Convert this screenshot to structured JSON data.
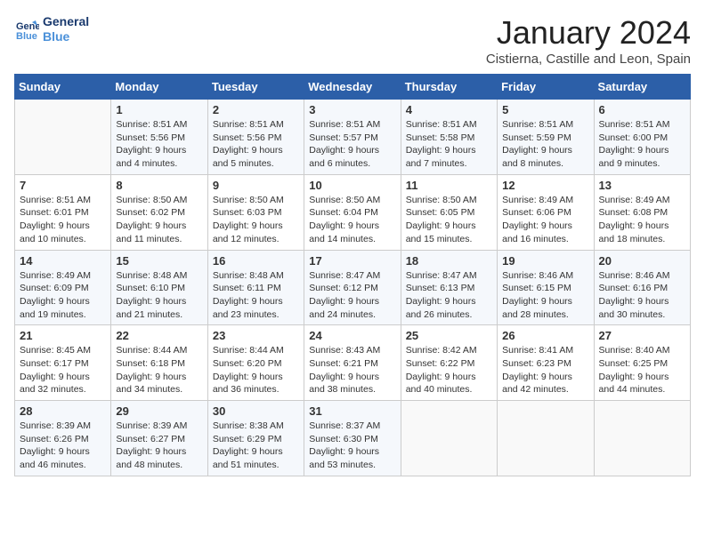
{
  "logo": {
    "line1": "General",
    "line2": "Blue"
  },
  "title": "January 2024",
  "subtitle": "Cistierna, Castille and Leon, Spain",
  "weekdays": [
    "Sunday",
    "Monday",
    "Tuesday",
    "Wednesday",
    "Thursday",
    "Friday",
    "Saturday"
  ],
  "weeks": [
    [
      {
        "day": "",
        "info": ""
      },
      {
        "day": "1",
        "info": "Sunrise: 8:51 AM\nSunset: 5:56 PM\nDaylight: 9 hours\nand 4 minutes."
      },
      {
        "day": "2",
        "info": "Sunrise: 8:51 AM\nSunset: 5:56 PM\nDaylight: 9 hours\nand 5 minutes."
      },
      {
        "day": "3",
        "info": "Sunrise: 8:51 AM\nSunset: 5:57 PM\nDaylight: 9 hours\nand 6 minutes."
      },
      {
        "day": "4",
        "info": "Sunrise: 8:51 AM\nSunset: 5:58 PM\nDaylight: 9 hours\nand 7 minutes."
      },
      {
        "day": "5",
        "info": "Sunrise: 8:51 AM\nSunset: 5:59 PM\nDaylight: 9 hours\nand 8 minutes."
      },
      {
        "day": "6",
        "info": "Sunrise: 8:51 AM\nSunset: 6:00 PM\nDaylight: 9 hours\nand 9 minutes."
      }
    ],
    [
      {
        "day": "7",
        "info": "Sunrise: 8:51 AM\nSunset: 6:01 PM\nDaylight: 9 hours\nand 10 minutes."
      },
      {
        "day": "8",
        "info": "Sunrise: 8:50 AM\nSunset: 6:02 PM\nDaylight: 9 hours\nand 11 minutes."
      },
      {
        "day": "9",
        "info": "Sunrise: 8:50 AM\nSunset: 6:03 PM\nDaylight: 9 hours\nand 12 minutes."
      },
      {
        "day": "10",
        "info": "Sunrise: 8:50 AM\nSunset: 6:04 PM\nDaylight: 9 hours\nand 14 minutes."
      },
      {
        "day": "11",
        "info": "Sunrise: 8:50 AM\nSunset: 6:05 PM\nDaylight: 9 hours\nand 15 minutes."
      },
      {
        "day": "12",
        "info": "Sunrise: 8:49 AM\nSunset: 6:06 PM\nDaylight: 9 hours\nand 16 minutes."
      },
      {
        "day": "13",
        "info": "Sunrise: 8:49 AM\nSunset: 6:08 PM\nDaylight: 9 hours\nand 18 minutes."
      }
    ],
    [
      {
        "day": "14",
        "info": "Sunrise: 8:49 AM\nSunset: 6:09 PM\nDaylight: 9 hours\nand 19 minutes."
      },
      {
        "day": "15",
        "info": "Sunrise: 8:48 AM\nSunset: 6:10 PM\nDaylight: 9 hours\nand 21 minutes."
      },
      {
        "day": "16",
        "info": "Sunrise: 8:48 AM\nSunset: 6:11 PM\nDaylight: 9 hours\nand 23 minutes."
      },
      {
        "day": "17",
        "info": "Sunrise: 8:47 AM\nSunset: 6:12 PM\nDaylight: 9 hours\nand 24 minutes."
      },
      {
        "day": "18",
        "info": "Sunrise: 8:47 AM\nSunset: 6:13 PM\nDaylight: 9 hours\nand 26 minutes."
      },
      {
        "day": "19",
        "info": "Sunrise: 8:46 AM\nSunset: 6:15 PM\nDaylight: 9 hours\nand 28 minutes."
      },
      {
        "day": "20",
        "info": "Sunrise: 8:46 AM\nSunset: 6:16 PM\nDaylight: 9 hours\nand 30 minutes."
      }
    ],
    [
      {
        "day": "21",
        "info": "Sunrise: 8:45 AM\nSunset: 6:17 PM\nDaylight: 9 hours\nand 32 minutes."
      },
      {
        "day": "22",
        "info": "Sunrise: 8:44 AM\nSunset: 6:18 PM\nDaylight: 9 hours\nand 34 minutes."
      },
      {
        "day": "23",
        "info": "Sunrise: 8:44 AM\nSunset: 6:20 PM\nDaylight: 9 hours\nand 36 minutes."
      },
      {
        "day": "24",
        "info": "Sunrise: 8:43 AM\nSunset: 6:21 PM\nDaylight: 9 hours\nand 38 minutes."
      },
      {
        "day": "25",
        "info": "Sunrise: 8:42 AM\nSunset: 6:22 PM\nDaylight: 9 hours\nand 40 minutes."
      },
      {
        "day": "26",
        "info": "Sunrise: 8:41 AM\nSunset: 6:23 PM\nDaylight: 9 hours\nand 42 minutes."
      },
      {
        "day": "27",
        "info": "Sunrise: 8:40 AM\nSunset: 6:25 PM\nDaylight: 9 hours\nand 44 minutes."
      }
    ],
    [
      {
        "day": "28",
        "info": "Sunrise: 8:39 AM\nSunset: 6:26 PM\nDaylight: 9 hours\nand 46 minutes."
      },
      {
        "day": "29",
        "info": "Sunrise: 8:39 AM\nSunset: 6:27 PM\nDaylight: 9 hours\nand 48 minutes."
      },
      {
        "day": "30",
        "info": "Sunrise: 8:38 AM\nSunset: 6:29 PM\nDaylight: 9 hours\nand 51 minutes."
      },
      {
        "day": "31",
        "info": "Sunrise: 8:37 AM\nSunset: 6:30 PM\nDaylight: 9 hours\nand 53 minutes."
      },
      {
        "day": "",
        "info": ""
      },
      {
        "day": "",
        "info": ""
      },
      {
        "day": "",
        "info": ""
      }
    ]
  ]
}
